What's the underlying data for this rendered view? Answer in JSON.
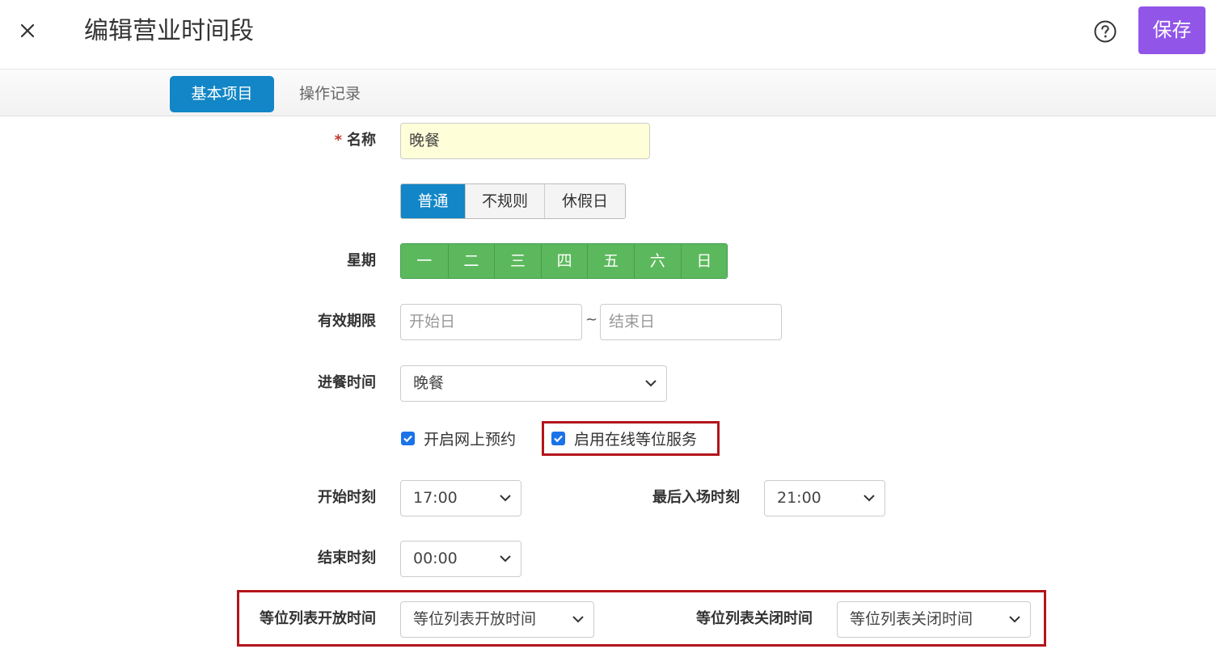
{
  "header": {
    "title": "编辑营业时间段",
    "save_label": "保存"
  },
  "tabs": [
    {
      "label": "基本项目",
      "active": true
    },
    {
      "label": "操作记录",
      "active": false
    }
  ],
  "form": {
    "name": {
      "label": "名称",
      "required_mark": "*",
      "value": "晚餐"
    },
    "day_type": {
      "options": [
        "普通",
        "不规则",
        "休假日"
      ],
      "selected": "普通"
    },
    "weekdays": {
      "label": "星期",
      "days": [
        "一",
        "二",
        "三",
        "四",
        "五",
        "六",
        "日"
      ]
    },
    "validity": {
      "label": "有效期限",
      "start_placeholder": "开始日",
      "separator": "~",
      "end_placeholder": "结束日"
    },
    "meal_time": {
      "label": "进餐时间",
      "value": "晚餐"
    },
    "online_reservation": {
      "label": "开启网上预约",
      "checked": true
    },
    "online_waitlist": {
      "label": "启用在线等位服务",
      "checked": true
    },
    "start_time": {
      "label": "开始时刻",
      "value": "17:00"
    },
    "last_entry": {
      "label": "最后入场时刻",
      "value": "21:00"
    },
    "end_time": {
      "label": "结束时刻",
      "value": "00:00"
    },
    "waitlist_open": {
      "label": "等位列表开放时间",
      "value": "等位列表开放时间"
    },
    "waitlist_close": {
      "label": "等位列表关闭时间",
      "value": "等位列表关闭时间"
    }
  },
  "colors": {
    "primary": "#1286c6",
    "save": "#9155e8",
    "days_green": "#5cb85c",
    "highlight_red": "#b3151c",
    "name_input_bg": "#fefed8"
  },
  "icons": [
    "close-icon",
    "help-icon",
    "chevron-down-icon",
    "checkmark-icon"
  ]
}
